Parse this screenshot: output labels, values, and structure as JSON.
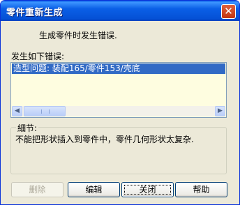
{
  "window": {
    "title": "零件重新生成"
  },
  "message": "生成零件时发生错误.",
  "error_list": {
    "label": "发生如下错误:",
    "items": [
      "造型问题: 装配165/零件153/壳底"
    ]
  },
  "details": {
    "label": "細节:",
    "text": "不能把形状插入到零件中，零件几何形状太复杂."
  },
  "buttons": {
    "delete": "删除",
    "edit": "编辑",
    "close": "关闭",
    "help": "帮助"
  },
  "icons": {
    "close": "close-icon",
    "scroll_left": "arrow-left-icon",
    "scroll_right": "arrow-right-icon"
  },
  "colors": {
    "titlebar": "#0a5fe6",
    "selection": "#316ac5",
    "list_background": "#fefde0",
    "dialog_background": "#ece9d8",
    "close_button": "#c13411"
  }
}
